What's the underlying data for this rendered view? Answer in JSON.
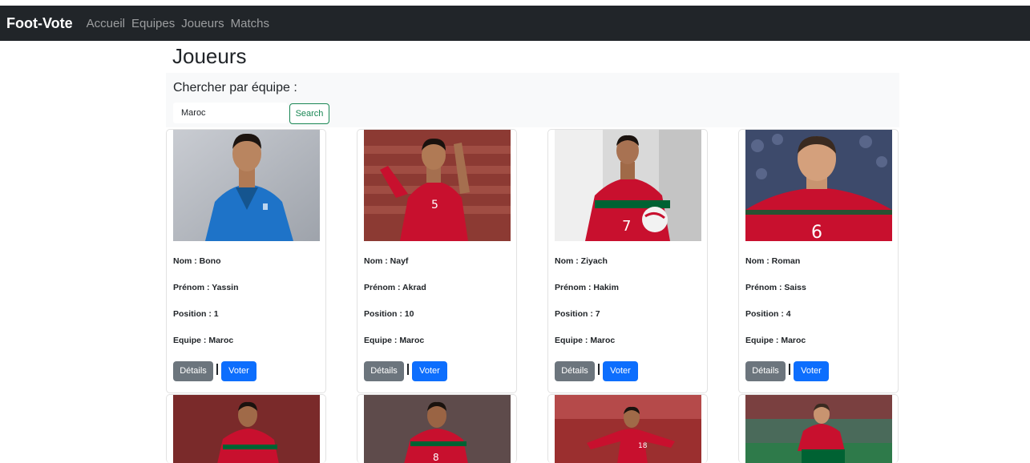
{
  "navbar": {
    "brand": "Foot-Vote",
    "links": [
      "Accueil",
      "Equipes",
      "Joueurs",
      "Matchs"
    ]
  },
  "page": {
    "title": "Joueurs"
  },
  "search": {
    "label": "Chercher par équipe :",
    "value": "Maroc",
    "button": "Search"
  },
  "players": [
    {
      "nom": "Nom : Bono",
      "prenom": "Prénom : Yassin",
      "position": "Position : 1",
      "equipe": "Equipe : Maroc",
      "details": "Détails",
      "voter": "Voter",
      "photo": "goalkeeper-blue-kit-photo"
    },
    {
      "nom": "Nom : Nayf",
      "prenom": "Prénom : Akrad",
      "position": "Position : 10",
      "equipe": "Equipe : Maroc",
      "details": "Détails",
      "voter": "Voter",
      "photo": "player-red-kit-pointing-photo"
    },
    {
      "nom": "Nom : Ziyach",
      "prenom": "Prénom : Hakim",
      "position": "Position : 7",
      "equipe": "Equipe : Maroc",
      "details": "Détails",
      "voter": "Voter",
      "photo": "player-red-kit-ball-photo"
    },
    {
      "nom": "Nom : Roman",
      "prenom": "Prénom : Saiss",
      "position": "Position : 4",
      "equipe": "Equipe : Maroc",
      "details": "Détails",
      "voter": "Voter",
      "photo": "player-red-kit-closeup-photo"
    }
  ],
  "more_photos": [
    "player-photo-5",
    "player-photo-6",
    "player-photo-7",
    "player-photo-8"
  ],
  "colors": {
    "navbar_bg": "#212529",
    "panel_bg": "#f8f9fa",
    "search_button": "#198754",
    "details_button": "#6c757d",
    "vote_button": "#0d6efd",
    "morocco_red": "#c8102e",
    "morocco_green": "#006233"
  }
}
